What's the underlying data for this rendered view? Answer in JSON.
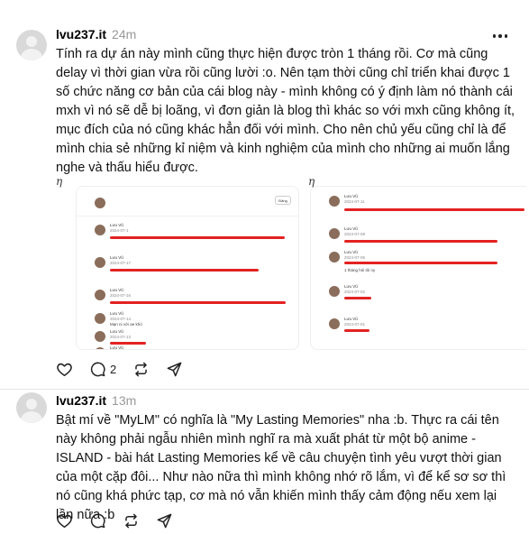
{
  "posts": [
    {
      "username": "lvu237.it",
      "time": "24m",
      "text": "Tính ra dự án này mình cũng thực hiện được tròn 1 tháng rồi. Cơ mà cũng delay vì thời gian vừa rồi cũng lười :o. Nên tạm thời cũng chỉ triển khai được 1 số chức năng cơ bản của cái blog này - mình không có ý định làm nó thành cái mxh vì nó sẽ dễ bị loãng, vì đơn giản là blog thì khác so với mxh cũng không ít, mục đích của nó cũng khác hẳn đối với mình. Cho nên chủ yếu cũng chỉ là để mình chia sẻ những kỉ niệm và kinh nghiệm của mình cho những ai muốn lắng nghe và thấu hiểu được.",
      "image_marks": [
        "η",
        "η"
      ],
      "screenshot1": {
        "button": "Đăng",
        "rows": [
          {
            "name": "Lưu Vũ",
            "time": "2024-07-1"
          },
          {
            "name": "Lưu Vũ",
            "time": "2024-07-17"
          },
          {
            "name": "Lưu Vũ",
            "time": "2024-07-16"
          },
          {
            "name": "Lưu Vũ",
            "time": "2024-07-14",
            "note": "Mạn ni với ae khó"
          },
          {
            "name": "Lưu Vũ",
            "time": "2024-07-13"
          },
          {
            "name": "Lưu Vũ",
            "time": "2024-07-12"
          }
        ]
      },
      "screenshot2": {
        "rows": [
          {
            "name": "Lưu Vũ",
            "time": "2024-07-11"
          },
          {
            "name": "Lưu Vũ",
            "time": "2024-07-08"
          },
          {
            "name": "Lưu Vũ",
            "time": "2024-07-05",
            "note": "1 tháng hỏi tôi ny"
          },
          {
            "name": "Lưu Vũ",
            "time": "2024-07-02"
          },
          {
            "name": "Lưu Vũ",
            "time": "2024-07-01"
          }
        ]
      },
      "reply_count": "2",
      "icons": [
        "heart-icon",
        "comment-icon",
        "repost-icon",
        "share-icon"
      ]
    },
    {
      "username": "lvu237.it",
      "time": "13m",
      "text": "Bật mí về \"MyLM\" có nghĩa là \"My Lasting Memories\" nha :b. Thực ra cái tên này không phải ngẫu nhiên mình nghĩ ra mà xuất phát từ một bộ anime - ISLAND - bài hát Lasting Memories kể về câu chuyện tình yêu vượt thời gian của một cặp đôi... Như nào nữa thì mình không nhớ rõ lắm, vì để kể sơ sơ thì nó cũng khá phức tạp, cơ mà nó vẫn khiến mình thấy cảm động nếu xem lại lần nữa :b",
      "icons": [
        "heart-icon",
        "comment-icon",
        "repost-icon",
        "share-icon"
      ]
    }
  ],
  "colors": {
    "redaction": "#e32222",
    "muted": "#999999",
    "divider": "#e6e6e6"
  }
}
